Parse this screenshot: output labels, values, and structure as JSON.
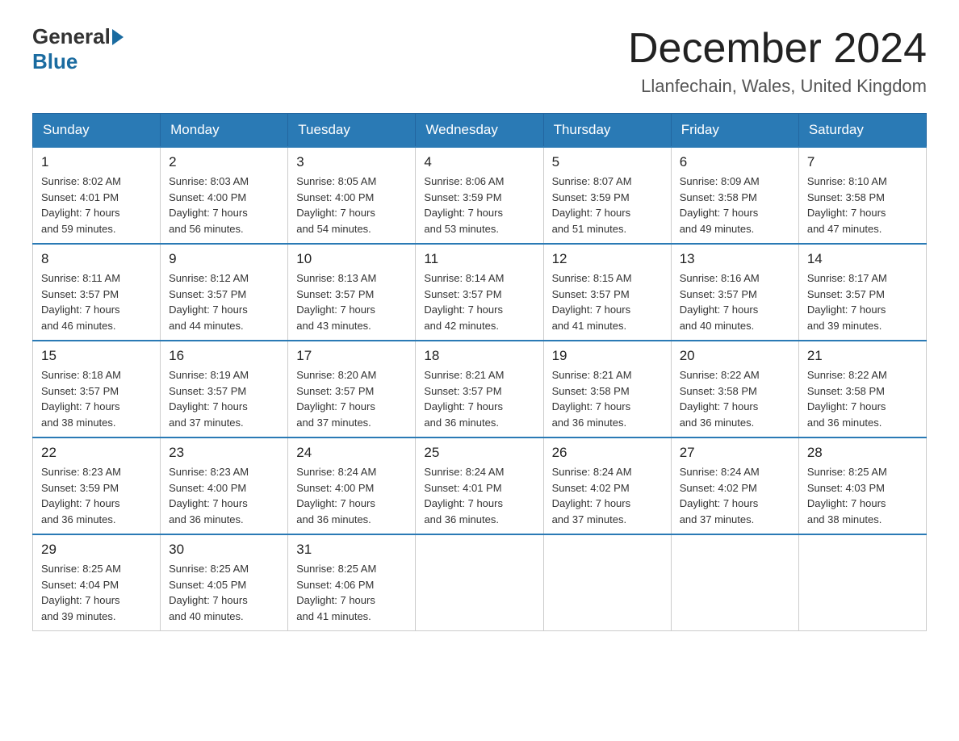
{
  "header": {
    "logo_general": "General",
    "logo_blue": "Blue",
    "month_title": "December 2024",
    "location": "Llanfechain, Wales, United Kingdom"
  },
  "days_of_week": [
    "Sunday",
    "Monday",
    "Tuesday",
    "Wednesday",
    "Thursday",
    "Friday",
    "Saturday"
  ],
  "weeks": [
    [
      {
        "day": "1",
        "sunrise": "Sunrise: 8:02 AM",
        "sunset": "Sunset: 4:01 PM",
        "daylight": "Daylight: 7 hours",
        "minutes": "and 59 minutes."
      },
      {
        "day": "2",
        "sunrise": "Sunrise: 8:03 AM",
        "sunset": "Sunset: 4:00 PM",
        "daylight": "Daylight: 7 hours",
        "minutes": "and 56 minutes."
      },
      {
        "day": "3",
        "sunrise": "Sunrise: 8:05 AM",
        "sunset": "Sunset: 4:00 PM",
        "daylight": "Daylight: 7 hours",
        "minutes": "and 54 minutes."
      },
      {
        "day": "4",
        "sunrise": "Sunrise: 8:06 AM",
        "sunset": "Sunset: 3:59 PM",
        "daylight": "Daylight: 7 hours",
        "minutes": "and 53 minutes."
      },
      {
        "day": "5",
        "sunrise": "Sunrise: 8:07 AM",
        "sunset": "Sunset: 3:59 PM",
        "daylight": "Daylight: 7 hours",
        "minutes": "and 51 minutes."
      },
      {
        "day": "6",
        "sunrise": "Sunrise: 8:09 AM",
        "sunset": "Sunset: 3:58 PM",
        "daylight": "Daylight: 7 hours",
        "minutes": "and 49 minutes."
      },
      {
        "day": "7",
        "sunrise": "Sunrise: 8:10 AM",
        "sunset": "Sunset: 3:58 PM",
        "daylight": "Daylight: 7 hours",
        "minutes": "and 47 minutes."
      }
    ],
    [
      {
        "day": "8",
        "sunrise": "Sunrise: 8:11 AM",
        "sunset": "Sunset: 3:57 PM",
        "daylight": "Daylight: 7 hours",
        "minutes": "and 46 minutes."
      },
      {
        "day": "9",
        "sunrise": "Sunrise: 8:12 AM",
        "sunset": "Sunset: 3:57 PM",
        "daylight": "Daylight: 7 hours",
        "minutes": "and 44 minutes."
      },
      {
        "day": "10",
        "sunrise": "Sunrise: 8:13 AM",
        "sunset": "Sunset: 3:57 PM",
        "daylight": "Daylight: 7 hours",
        "minutes": "and 43 minutes."
      },
      {
        "day": "11",
        "sunrise": "Sunrise: 8:14 AM",
        "sunset": "Sunset: 3:57 PM",
        "daylight": "Daylight: 7 hours",
        "minutes": "and 42 minutes."
      },
      {
        "day": "12",
        "sunrise": "Sunrise: 8:15 AM",
        "sunset": "Sunset: 3:57 PM",
        "daylight": "Daylight: 7 hours",
        "minutes": "and 41 minutes."
      },
      {
        "day": "13",
        "sunrise": "Sunrise: 8:16 AM",
        "sunset": "Sunset: 3:57 PM",
        "daylight": "Daylight: 7 hours",
        "minutes": "and 40 minutes."
      },
      {
        "day": "14",
        "sunrise": "Sunrise: 8:17 AM",
        "sunset": "Sunset: 3:57 PM",
        "daylight": "Daylight: 7 hours",
        "minutes": "and 39 minutes."
      }
    ],
    [
      {
        "day": "15",
        "sunrise": "Sunrise: 8:18 AM",
        "sunset": "Sunset: 3:57 PM",
        "daylight": "Daylight: 7 hours",
        "minutes": "and 38 minutes."
      },
      {
        "day": "16",
        "sunrise": "Sunrise: 8:19 AM",
        "sunset": "Sunset: 3:57 PM",
        "daylight": "Daylight: 7 hours",
        "minutes": "and 37 minutes."
      },
      {
        "day": "17",
        "sunrise": "Sunrise: 8:20 AM",
        "sunset": "Sunset: 3:57 PM",
        "daylight": "Daylight: 7 hours",
        "minutes": "and 37 minutes."
      },
      {
        "day": "18",
        "sunrise": "Sunrise: 8:21 AM",
        "sunset": "Sunset: 3:57 PM",
        "daylight": "Daylight: 7 hours",
        "minutes": "and 36 minutes."
      },
      {
        "day": "19",
        "sunrise": "Sunrise: 8:21 AM",
        "sunset": "Sunset: 3:58 PM",
        "daylight": "Daylight: 7 hours",
        "minutes": "and 36 minutes."
      },
      {
        "day": "20",
        "sunrise": "Sunrise: 8:22 AM",
        "sunset": "Sunset: 3:58 PM",
        "daylight": "Daylight: 7 hours",
        "minutes": "and 36 minutes."
      },
      {
        "day": "21",
        "sunrise": "Sunrise: 8:22 AM",
        "sunset": "Sunset: 3:58 PM",
        "daylight": "Daylight: 7 hours",
        "minutes": "and 36 minutes."
      }
    ],
    [
      {
        "day": "22",
        "sunrise": "Sunrise: 8:23 AM",
        "sunset": "Sunset: 3:59 PM",
        "daylight": "Daylight: 7 hours",
        "minutes": "and 36 minutes."
      },
      {
        "day": "23",
        "sunrise": "Sunrise: 8:23 AM",
        "sunset": "Sunset: 4:00 PM",
        "daylight": "Daylight: 7 hours",
        "minutes": "and 36 minutes."
      },
      {
        "day": "24",
        "sunrise": "Sunrise: 8:24 AM",
        "sunset": "Sunset: 4:00 PM",
        "daylight": "Daylight: 7 hours",
        "minutes": "and 36 minutes."
      },
      {
        "day": "25",
        "sunrise": "Sunrise: 8:24 AM",
        "sunset": "Sunset: 4:01 PM",
        "daylight": "Daylight: 7 hours",
        "minutes": "and 36 minutes."
      },
      {
        "day": "26",
        "sunrise": "Sunrise: 8:24 AM",
        "sunset": "Sunset: 4:02 PM",
        "daylight": "Daylight: 7 hours",
        "minutes": "and 37 minutes."
      },
      {
        "day": "27",
        "sunrise": "Sunrise: 8:24 AM",
        "sunset": "Sunset: 4:02 PM",
        "daylight": "Daylight: 7 hours",
        "minutes": "and 37 minutes."
      },
      {
        "day": "28",
        "sunrise": "Sunrise: 8:25 AM",
        "sunset": "Sunset: 4:03 PM",
        "daylight": "Daylight: 7 hours",
        "minutes": "and 38 minutes."
      }
    ],
    [
      {
        "day": "29",
        "sunrise": "Sunrise: 8:25 AM",
        "sunset": "Sunset: 4:04 PM",
        "daylight": "Daylight: 7 hours",
        "minutes": "and 39 minutes."
      },
      {
        "day": "30",
        "sunrise": "Sunrise: 8:25 AM",
        "sunset": "Sunset: 4:05 PM",
        "daylight": "Daylight: 7 hours",
        "minutes": "and 40 minutes."
      },
      {
        "day": "31",
        "sunrise": "Sunrise: 8:25 AM",
        "sunset": "Sunset: 4:06 PM",
        "daylight": "Daylight: 7 hours",
        "minutes": "and 41 minutes."
      },
      null,
      null,
      null,
      null
    ]
  ]
}
